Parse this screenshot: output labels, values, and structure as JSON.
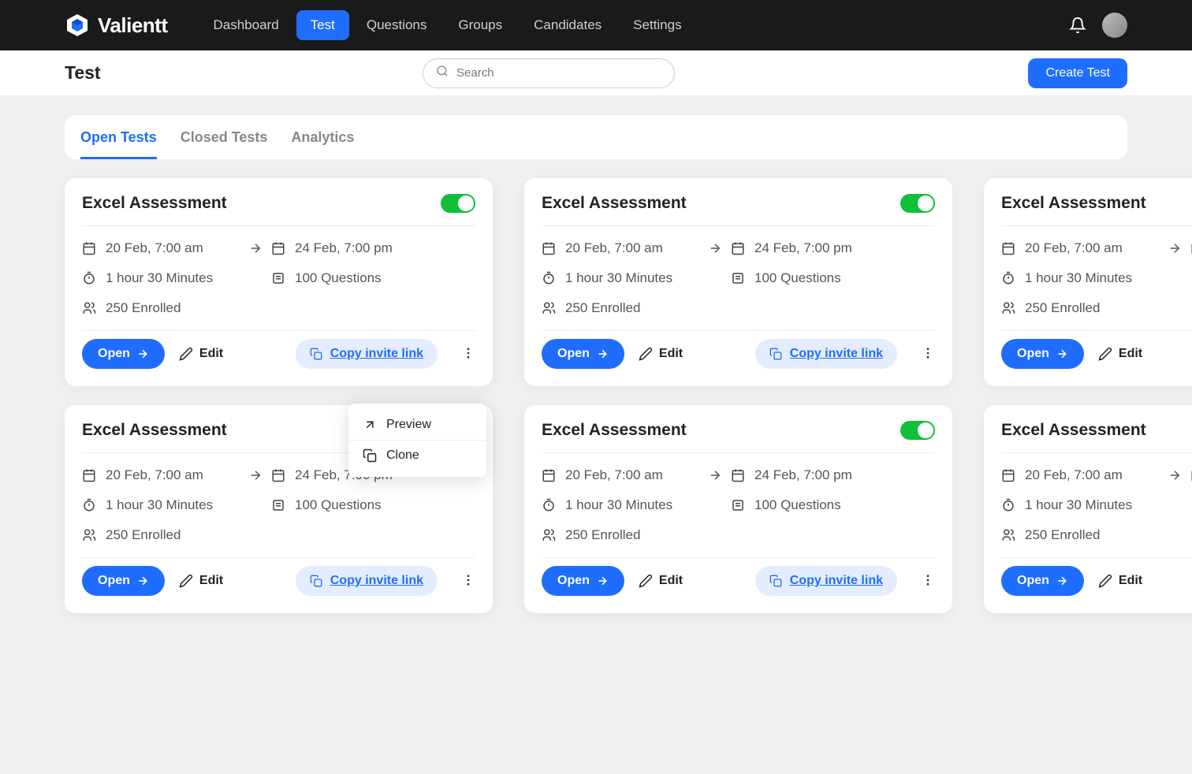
{
  "brand": "Valientt",
  "nav": {
    "items": [
      "Dashboard",
      "Test",
      "Questions",
      "Groups",
      "Candidates",
      "Settings"
    ],
    "active": 1
  },
  "page_title": "Test",
  "search": {
    "placeholder": "Search"
  },
  "create_button": "Create Test",
  "tabs": {
    "items": [
      "Open Tests",
      "Closed Tests",
      "Analytics"
    ],
    "active": 0
  },
  "card": {
    "title": "Excel Assessment",
    "start": "20 Feb, 7:00 am",
    "end": "24 Feb, 7:00 pm",
    "duration": "1 hour 30 Minutes",
    "questions": "100 Questions",
    "enrolled": "250 Enrolled",
    "open": "Open",
    "edit": "Edit",
    "copy": "Copy invite link"
  },
  "dropdown": {
    "preview": "Preview",
    "clone": "Clone"
  }
}
